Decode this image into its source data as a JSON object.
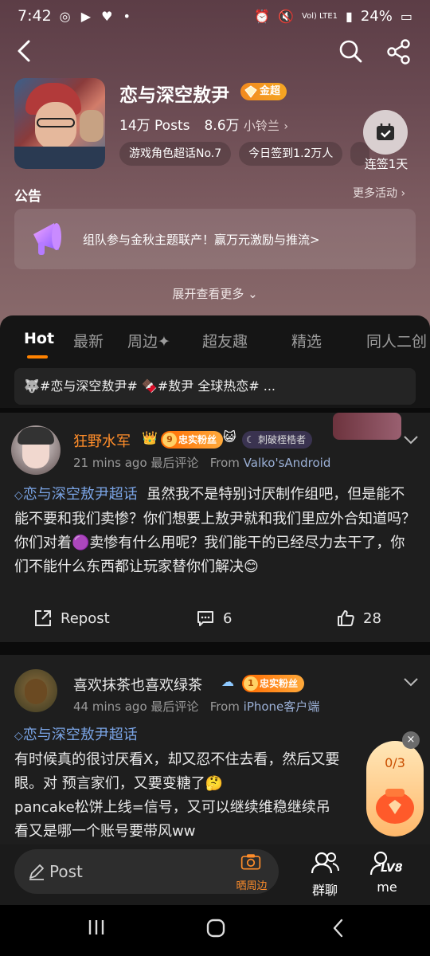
{
  "status_bar": {
    "time": "7:42",
    "left_icons": "◎ ▶ ♥ •",
    "network": "Vol) LTE1",
    "battery": "24%"
  },
  "community": {
    "title": "恋与深空敖尹",
    "badge": "金超",
    "posts": "14万 Posts",
    "followers": "8.6万",
    "moderator": "小铃兰",
    "tags": [
      "游戏角色超话No.7",
      "今日签到1.2万人"
    ],
    "checkin_label": "连签1天"
  },
  "notice": {
    "title": "公告",
    "more": "更多活动",
    "text": "组队参与金秋主题联产！赢万元激励与推流>",
    "expand": "展开查看更多"
  },
  "tabs": [
    "Hot",
    "最新",
    "周边✦",
    "超友趣",
    "精选",
    "同人二创"
  ],
  "topic_bar": "🐺#恋与深空敖尹# 🍫#敖尹 全球热恋# ...",
  "posts": [
    {
      "username": "狂野水军",
      "badge_level": "9",
      "badge_text": "忠实粉丝",
      "chip": "刺破桎梏者",
      "time": "21 mins ago 最后评论",
      "source_prefix": "From",
      "source": "Valko'sAndroid",
      "topic": "恋与深空敖尹超话",
      "body": "虽然我不是特别讨厌制作组吧，但是能不能不要和我们卖惨？你们想要上敖尹就和我们里应外合知道吗？你们对着🟣卖惨有什么用呢？我们能干的已经尽力去干了，你们不能什么东西都让玩家替你们解决😊",
      "repost": "Repost",
      "comments": "6",
      "likes": "28"
    },
    {
      "username": "喜欢抹茶也喜欢绿茶",
      "badge_level": "1",
      "badge_text": "忠实粉丝",
      "time": "44 mins ago 最后评论",
      "source_prefix": "From",
      "source": "iPhone客户端",
      "topic": "恋与深空敖尹超话",
      "lines": [
        "有时候真的很讨厌看X，却又忍不住去看，然后又要",
        "眼。对 预言家们，又要变糖了🤔",
        "pancake松饼上线=信号，又可以继续维稳继续吊",
        "看又是哪一个账号要带风ww"
      ]
    }
  ],
  "float_widget": {
    "count": "0/3",
    "close": "×"
  },
  "bottom": {
    "post_label": "Post",
    "camera_label": "晒周边",
    "group_chat": "群聊",
    "me": "me",
    "level": "LV8"
  },
  "colors": {
    "accent": "#ff8200",
    "link": "#7aa4e5",
    "username_orange": "#ff8d2a"
  }
}
